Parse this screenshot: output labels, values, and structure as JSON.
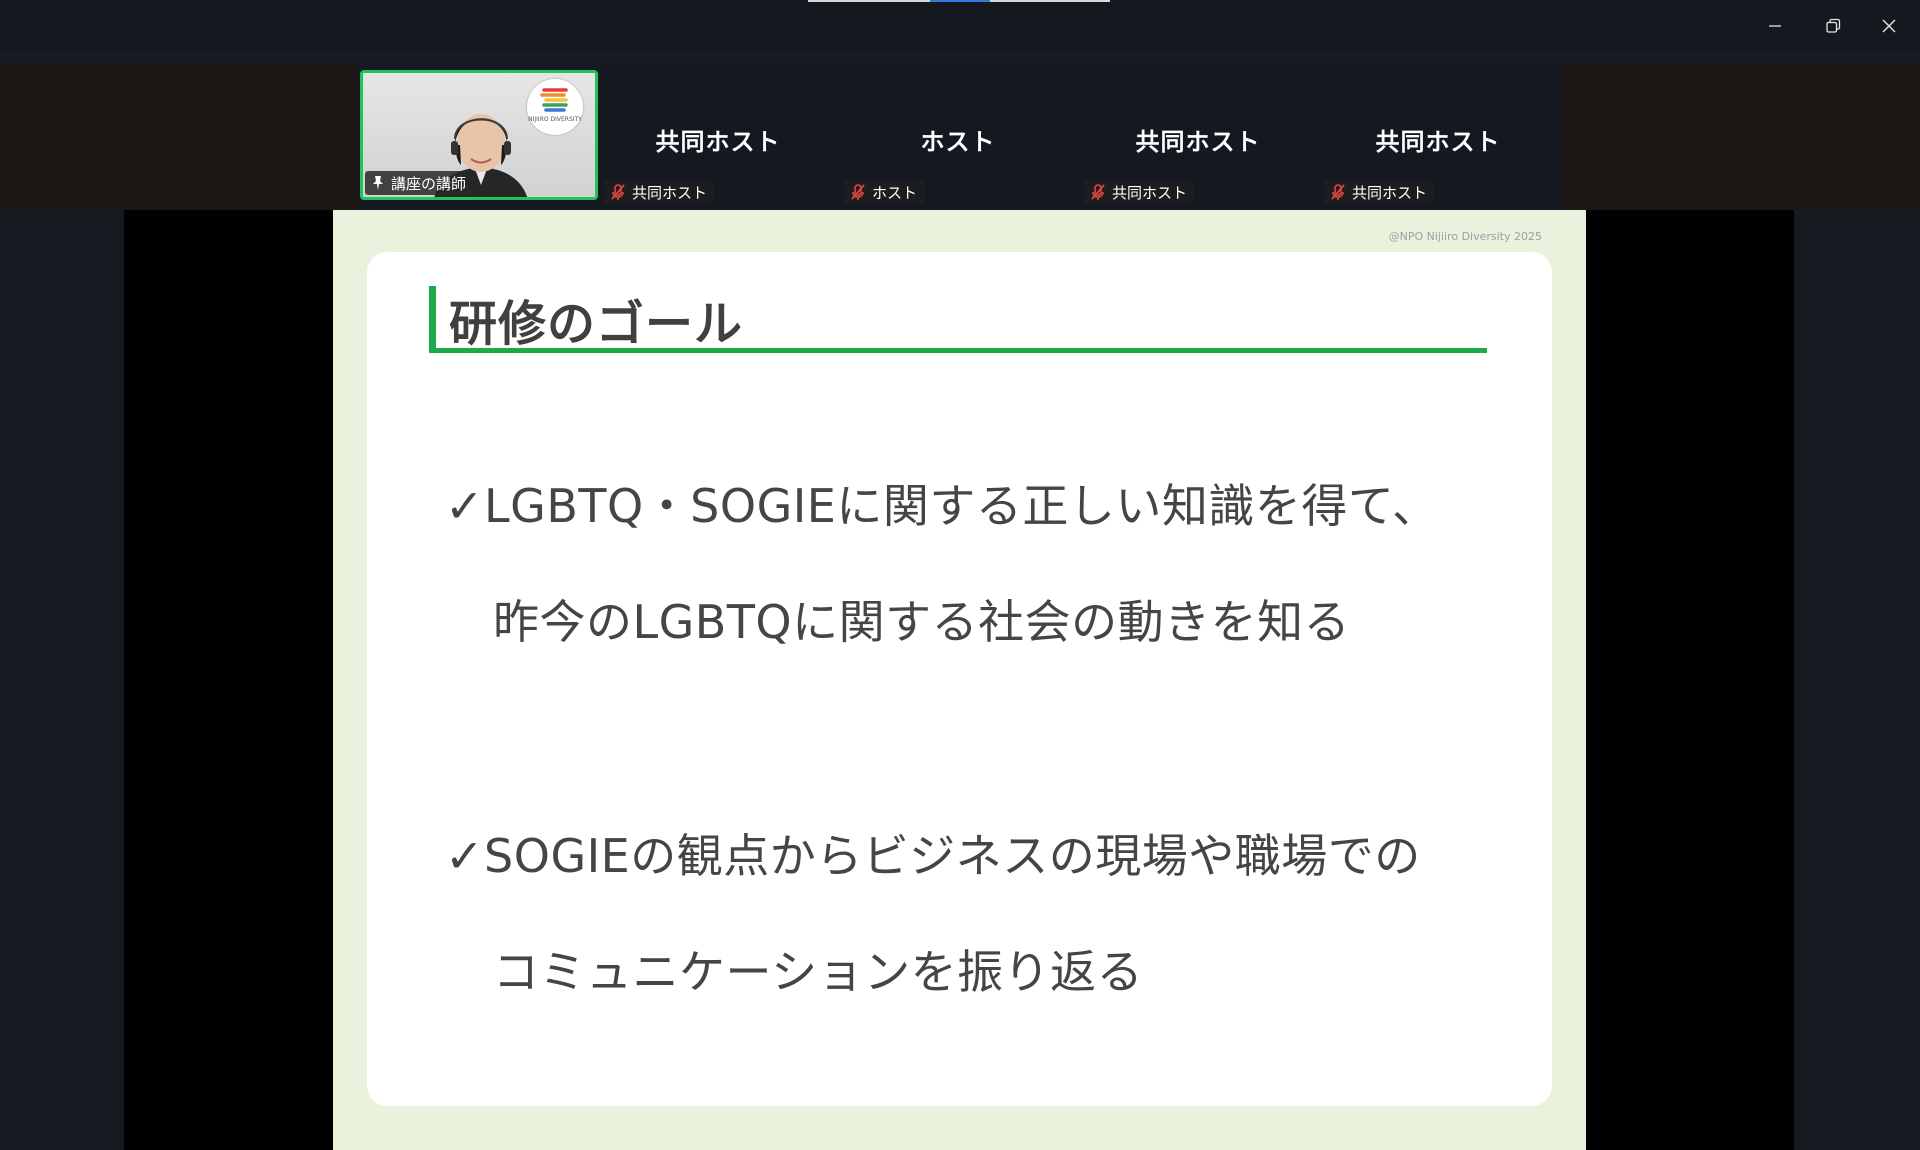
{
  "gallery": {
    "speaker": {
      "label": "講座の講師",
      "logo_text": "NIJIIRO DIVERSITY"
    },
    "tiles": [
      {
        "name": "共同ホスト",
        "label": "共同ホスト"
      },
      {
        "name": "ホスト",
        "label": "ホスト"
      },
      {
        "name": "共同ホスト",
        "label": "共同ホスト"
      },
      {
        "name": "共同ホスト",
        "label": "共同ホスト"
      }
    ]
  },
  "slide": {
    "copyright": "@NPO Nijiiro Diversity 2025",
    "title": "研修のゴール",
    "goals": [
      {
        "line1": "✓LGBTQ・SOGIEに関する正しい知識を得て、",
        "line2": "昨今のLGBTQに関する社会の動きを知る"
      },
      {
        "line1": "✓SOGIEの観点からビジネスの現場や職場での",
        "line2": "コミュニケーションを振り返る"
      }
    ]
  },
  "colors": {
    "accent_green": "#1faa49",
    "slide_bg": "#e8f2dc",
    "muted_mic": "#e0453d"
  }
}
